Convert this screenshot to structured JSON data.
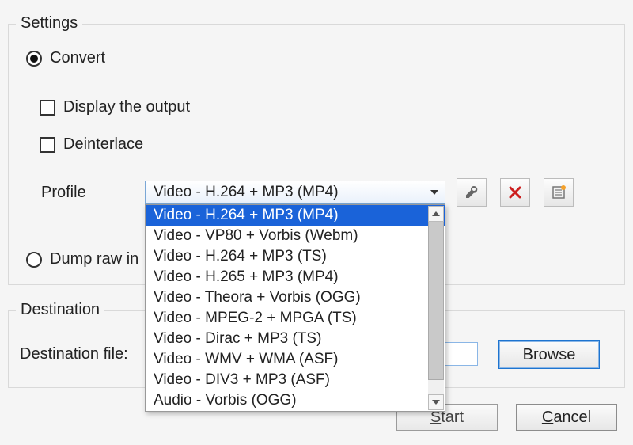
{
  "settings": {
    "group_title": "Settings",
    "convert_label": "Convert",
    "display_output_label": "Display the output",
    "deinterlace_label": "Deinterlace",
    "profile_label": "Profile",
    "profile_selected": "Video - H.264 + MP3 (MP4)",
    "profile_options": [
      "Video - H.264 + MP3 (MP4)",
      "Video - VP80 + Vorbis (Webm)",
      "Video - H.264 + MP3 (TS)",
      "Video - H.265 + MP3 (MP4)",
      "Video - Theora + Vorbis (OGG)",
      "Video - MPEG-2 + MPGA (TS)",
      "Video - Dirac + MP3 (TS)",
      "Video - WMV + WMA (ASF)",
      "Video - DIV3 + MP3 (ASF)",
      "Audio - Vorbis (OGG)"
    ],
    "dump_raw_label": "Dump raw in"
  },
  "destination": {
    "group_title": "Destination",
    "dest_file_label": "Destination file:",
    "dest_file_value": "",
    "browse_label": "Browse"
  },
  "buttons": {
    "start_label": "Start",
    "cancel_label": "Cancel"
  },
  "icons": {
    "wrench": "wrench-icon",
    "delete": "delete-icon",
    "new_profile": "new-profile-icon"
  },
  "colors": {
    "highlight": "#1a63d9",
    "border_blue": "#7aa7d6",
    "panel_bg": "#f5f5f5"
  }
}
